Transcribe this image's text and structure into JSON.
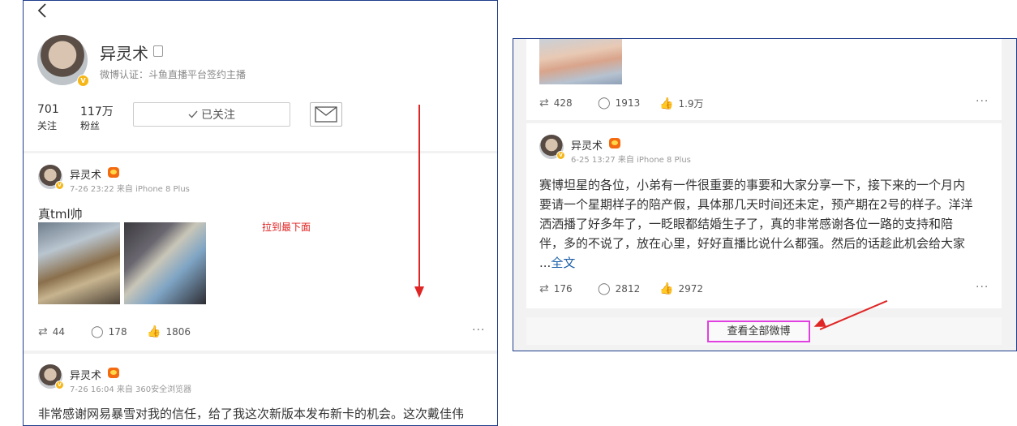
{
  "left": {
    "profile": {
      "back_icon": "chevron-left-icon",
      "name": "异灵术",
      "certification": "微博认证：斗鱼直播平台签约主播",
      "following_count": "701",
      "following_label": "关注",
      "followers_count": "117万",
      "followers_label": "粉丝",
      "follow_button": "已关注",
      "follow_icon": "check-icon",
      "message_icon": "mail-icon"
    },
    "annotation": "拉到最下面",
    "posts": [
      {
        "author": "异灵术",
        "meta": "7-26 23:22 来自 iPhone 8 Plus",
        "text": "真tml帅",
        "reposts": "44",
        "comments": "178",
        "likes": "1806",
        "more": "···"
      },
      {
        "author": "异灵术",
        "meta": "7-26 16:04 来自 360安全浏览器",
        "text": "非常感谢网易暴雪对我的信任，给了我这次新版本发布新卡的机会。这次戴佳伟"
      }
    ]
  },
  "right": {
    "top_post": {
      "reposts": "428",
      "comments": "1913",
      "likes": "1.9万",
      "more": "···"
    },
    "post": {
      "author": "异灵术",
      "meta": "6-25 13:27 来自 iPhone 8 Plus",
      "lines": [
        "赛博坦星的各位，小弟有一件很重要的事要和大家分享一下，接下来的一个月内",
        "要请一个星期样子的陪产假，具体那几天时间还未定，预产期在2号的样子。洋洋",
        "洒洒播了好多年了，一眨眼都结婚生子了，真的非常感谢各位一路的支持和陪",
        "伴，多的不说了，放在心里，好好直播比说什么都强。然后的话趁此机会给大家"
      ],
      "ellipsis": "...",
      "full_text_link": "全文",
      "reposts": "176",
      "comments": "2812",
      "likes": "2972",
      "more": "···"
    },
    "view_all": "查看全部微博"
  },
  "colors": {
    "panel_border": "#1f3d8c",
    "annotation_red": "#e02525",
    "highlight_magenta": "#e040e0",
    "link_blue": "#1a5ea8",
    "verified_gold": "#f5b617"
  }
}
